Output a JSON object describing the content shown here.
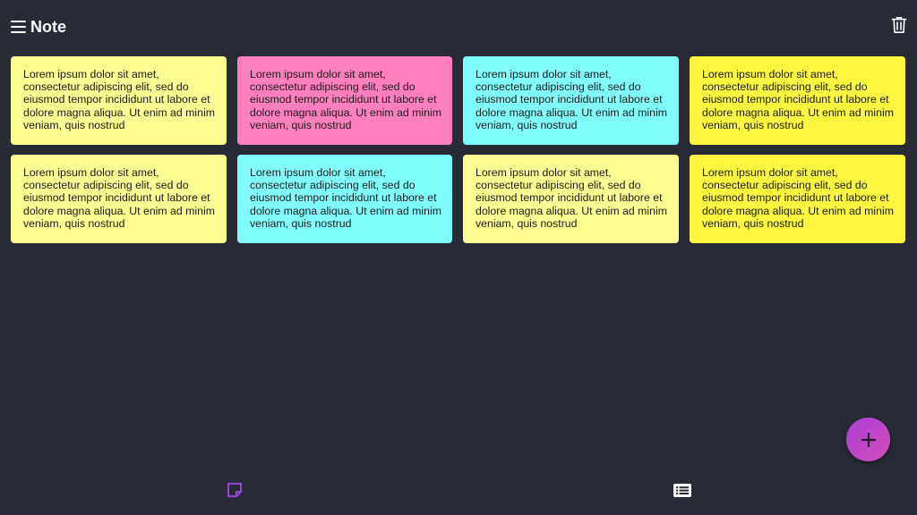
{
  "header": {
    "title": "Note",
    "menu_icon": "hamburger-menu-icon",
    "trash_icon": "trash-icon"
  },
  "notes": [
    {
      "text": "Lorem ipsum dolor sit amet, consectetur adipiscing elit, sed do eiusmod tempor incididunt ut labore et dolore magna aliqua. Ut enim ad minim veniam, quis nostrud",
      "color": "#fbfc91"
    },
    {
      "text": "Lorem ipsum dolor sit amet, consectetur adipiscing elit, sed do eiusmod tempor incididunt ut labore et dolore magna aliqua. Ut enim ad minim veniam, quis nostrud",
      "color": "#fd7fbd"
    },
    {
      "text": "Lorem ipsum dolor sit amet, consectetur adipiscing elit, sed do eiusmod tempor incididunt ut labore et dolore magna aliqua. Ut enim ad minim veniam, quis nostrud",
      "color": "#80fcfd"
    },
    {
      "text": "Lorem ipsum dolor sit amet, consectetur adipiscing elit, sed do eiusmod tempor incididunt ut labore et dolore magna aliqua. Ut enim ad minim veniam, quis nostrud",
      "color": "#fdf641"
    },
    {
      "text": "Lorem ipsum dolor sit amet, consectetur adipiscing elit, sed do eiusmod tempor incididunt ut labore et dolore magna aliqua. Ut enim ad minim veniam, quis nostrud",
      "color": "#fbfc91"
    },
    {
      "text": "Lorem ipsum dolor sit amet, consectetur adipiscing elit, sed do eiusmod tempor incididunt ut labore et dolore magna aliqua. Ut enim ad minim veniam, quis nostrud",
      "color": "#80fcfd"
    },
    {
      "text": "Lorem ipsum dolor sit amet, consectetur adipiscing elit, sed do eiusmod tempor incididunt ut labore et dolore magna aliqua. Ut enim ad minim veniam, quis nostrud",
      "color": "#fbfc91"
    },
    {
      "text": "Lorem ipsum dolor sit amet, consectetur adipiscing elit, sed do eiusmod tempor incididunt ut labore et dolore magna aliqua. Ut enim ad minim veniam, quis nostrud",
      "color": "#fdf641"
    }
  ],
  "fab": {
    "icon": "plus-icon",
    "colors": [
      "#a93fd6",
      "#d54db9"
    ]
  },
  "bottom_nav": {
    "items": [
      {
        "icon": "sticky-note-icon",
        "active": true,
        "color": "#9b4ce8"
      },
      {
        "icon": "list-icon",
        "active": false,
        "color": "#ffffff"
      }
    ]
  },
  "colors": {
    "background": "#282a36",
    "accent": "#9b4ce8",
    "text_light": "#ffffff"
  }
}
